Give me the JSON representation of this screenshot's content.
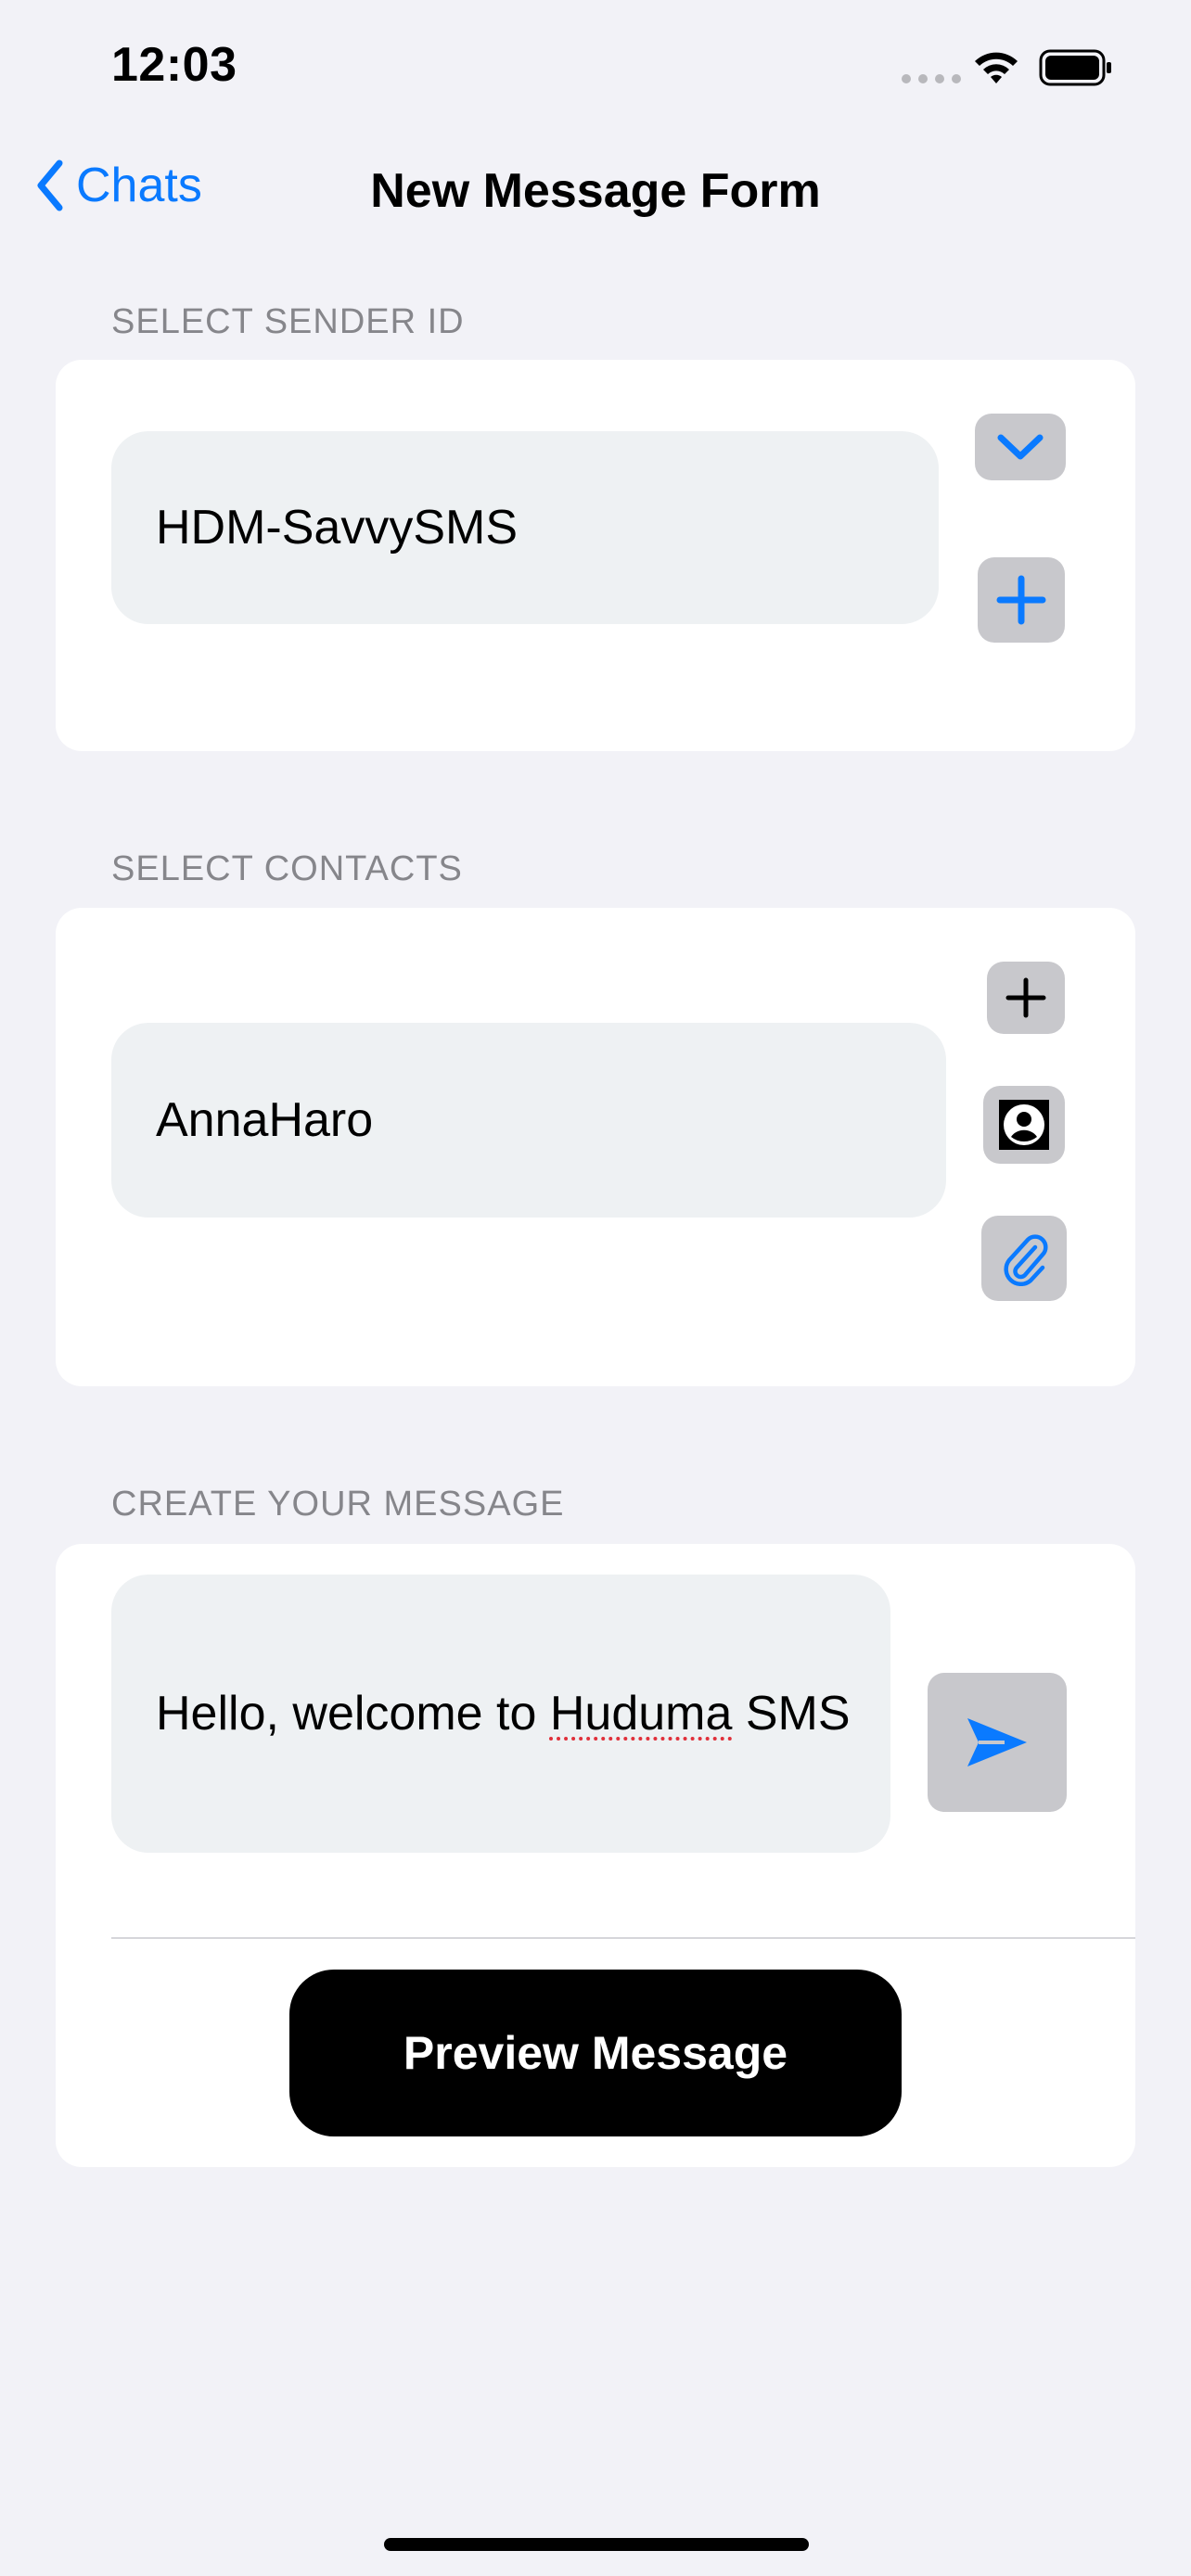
{
  "status_bar": {
    "time": "12:03"
  },
  "nav": {
    "back_label": "Chats",
    "title": "New Message Form"
  },
  "sender_section": {
    "header": "SELECT SENDER ID",
    "value": "HDM-SavvySMS",
    "icons": [
      "chevron-down-icon",
      "plus-icon"
    ]
  },
  "contacts_section": {
    "header": "SELECT CONTACTS",
    "value": "AnnaHaro",
    "icons": [
      "plus-icon",
      "contact-icon",
      "paperclip-icon"
    ]
  },
  "message_section": {
    "header": "CREATE YOUR MESSAGE",
    "value_prefix": "Hello, welcome to ",
    "value_misspelled": "Huduma",
    "value_suffix": " SMS",
    "send_icon": "send-icon"
  },
  "preview_button": {
    "label": "Preview Message"
  },
  "colors": {
    "accent": "#0a7aff",
    "background": "#f2f2f7",
    "field": "#eef1f3",
    "button": "#000000"
  }
}
